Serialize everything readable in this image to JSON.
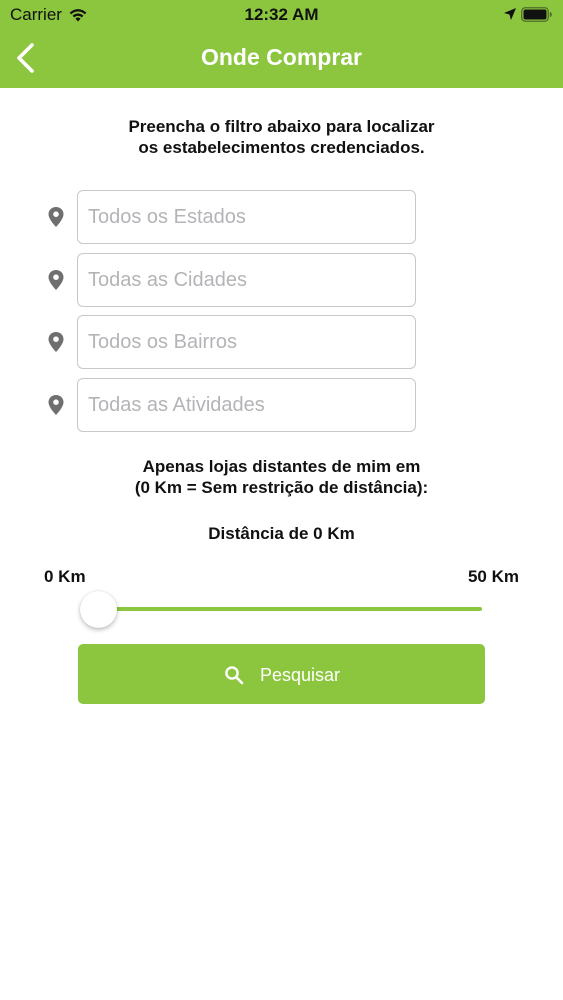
{
  "status_bar": {
    "carrier": "Carrier",
    "time": "12:32 AM"
  },
  "header": {
    "title": "Onde Comprar",
    "background_color": "#8cc63f"
  },
  "instructions": {
    "line1": "Preencha o filtro abaixo para localizar",
    "line2": "os estabelecimentos credenciados."
  },
  "filters": {
    "state_placeholder": "Todos os Estados",
    "state_value": "",
    "city_placeholder": "Todas as Cidades",
    "city_value": "",
    "neighborhood_placeholder": "Todos os Bairros",
    "neighborhood_value": "",
    "activity_placeholder": "Todas as Atividades",
    "activity_value": ""
  },
  "distance": {
    "note_line1": "Apenas lojas distantes de mim em",
    "note_line2": "(0 Km = Sem restrição de distância):",
    "label": "Distância de 0 Km",
    "min_label": "0 Km",
    "max_label": "50 Km",
    "min": 0,
    "max": 50,
    "value": 0
  },
  "search": {
    "label": "Pesquisar"
  },
  "icons": {
    "back": "chevron-left-icon",
    "pin": "map-pin-icon",
    "search": "search-icon",
    "wifi": "wifi-icon",
    "location": "location-arrow-icon",
    "battery": "battery-icon"
  }
}
